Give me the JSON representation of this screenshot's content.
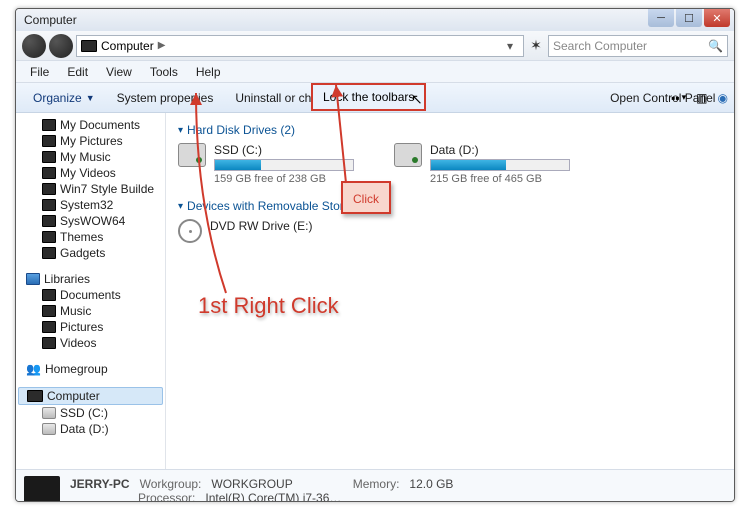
{
  "window": {
    "title": "Computer"
  },
  "address": {
    "root": "Computer",
    "search_placeholder": "Search Computer"
  },
  "menubar": [
    "File",
    "Edit",
    "View",
    "Tools",
    "Help"
  ],
  "toolbar": {
    "organize": "Organize",
    "sysprops": "System properties",
    "uninstall": "Uninstall or change a",
    "opencp": "Open Control Panel",
    "context_item": "Lock the toolbars"
  },
  "sidebar": {
    "favorites": [
      {
        "label": "My Documents",
        "icon": "dark"
      },
      {
        "label": "My Pictures",
        "icon": "dark"
      },
      {
        "label": "My Music",
        "icon": "dark"
      },
      {
        "label": "My Videos",
        "icon": "dark"
      },
      {
        "label": "Win7 Style Builde",
        "icon": "dark"
      },
      {
        "label": "System32",
        "icon": "dark"
      },
      {
        "label": "SysWOW64",
        "icon": "dark"
      },
      {
        "label": "Themes",
        "icon": "dark"
      },
      {
        "label": "Gadgets",
        "icon": "dark"
      }
    ],
    "libraries_label": "Libraries",
    "libraries": [
      {
        "label": "Documents"
      },
      {
        "label": "Music"
      },
      {
        "label": "Pictures"
      },
      {
        "label": "Videos"
      }
    ],
    "homegroup": "Homegroup",
    "computer": "Computer",
    "drives": [
      {
        "label": "SSD (C:)"
      },
      {
        "label": "Data (D:)"
      }
    ]
  },
  "content": {
    "group_hdd": "Hard Disk Drives (2)",
    "group_removable": "Devices with Removable Storag",
    "drives": [
      {
        "name": "SSD (C:)",
        "free": "159 GB free of 238 GB",
        "fill_pct": 33
      },
      {
        "name": "Data (D:)",
        "free": "215 GB free of 465 GB",
        "fill_pct": 54
      }
    ],
    "dvd": {
      "name": "DVD RW Drive (E:)"
    }
  },
  "status": {
    "pcname": "JERRY-PC",
    "workgroup_label": "Workgroup:",
    "workgroup": "WORKGROUP",
    "memory_label": "Memory:",
    "memory": "12.0 GB",
    "cpu_label": "Processor:",
    "cpu": "Intel(R) Core(TM) i7-36…"
  },
  "annotations": {
    "click": "Click",
    "rightclick": "1st Right Click"
  }
}
